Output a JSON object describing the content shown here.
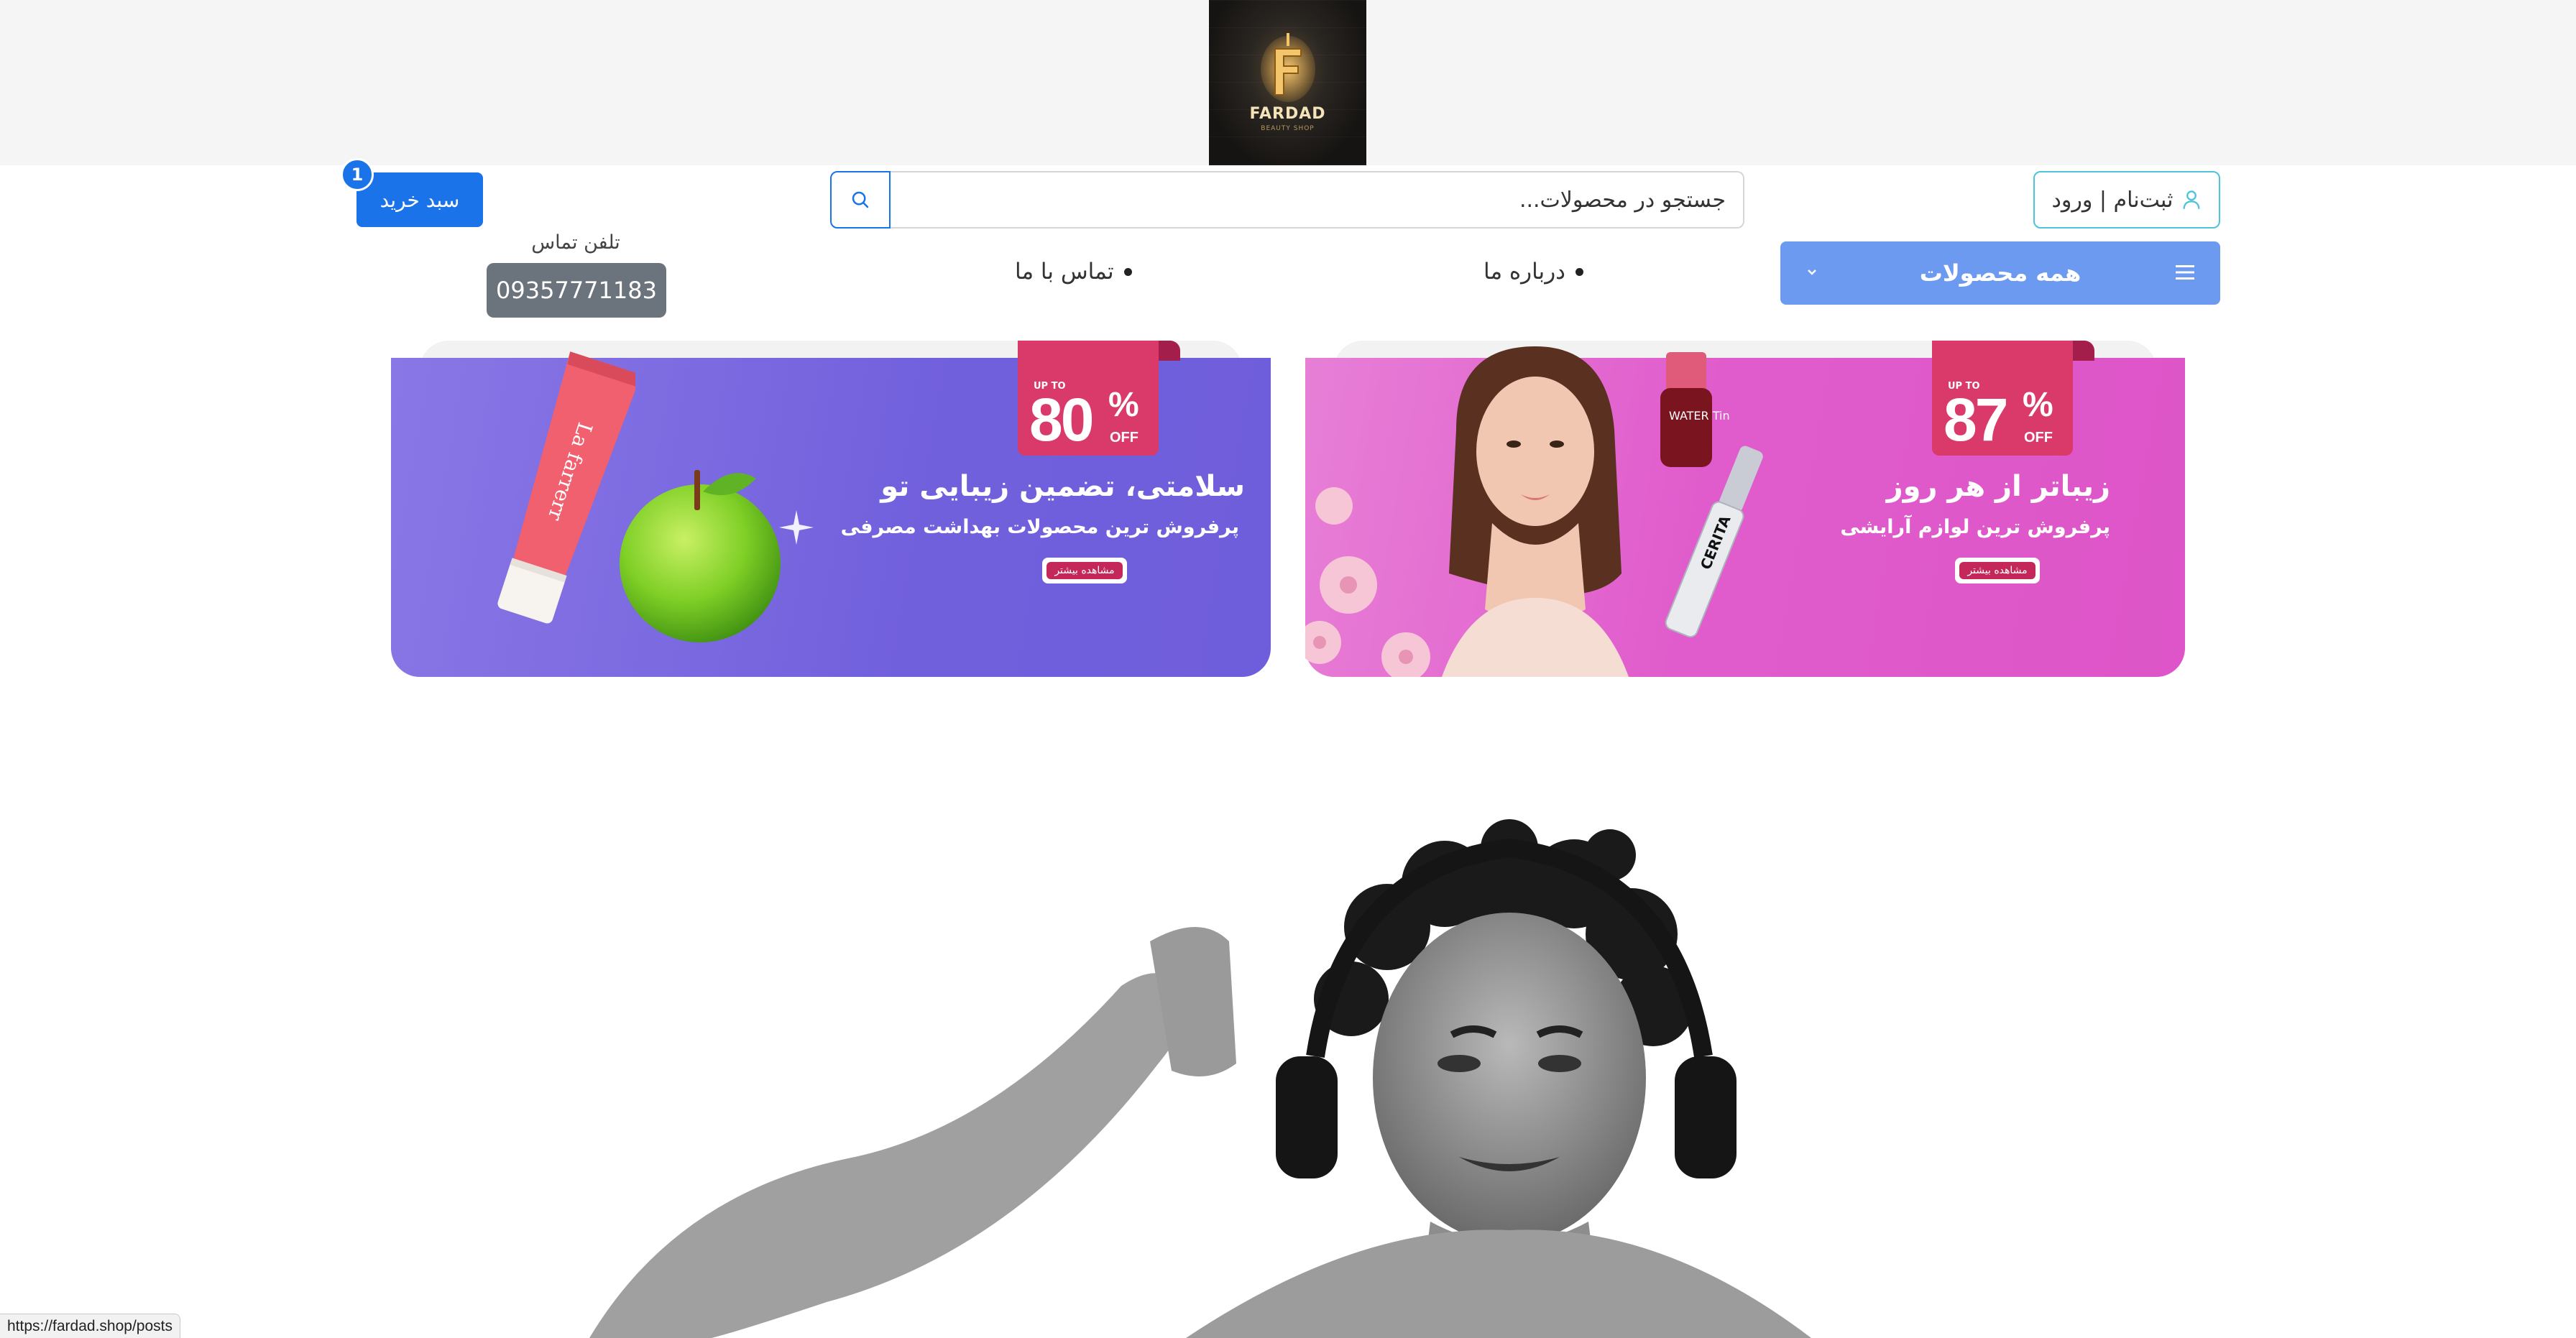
{
  "header": {
    "logo_text": "FARDAD",
    "logo_subtext": "BEAUTY SHOP",
    "cart_label": "سبد خرید",
    "cart_count": "1",
    "search_placeholder": "جستجو در محصولات...",
    "login_label": "ثبت‌نام | ورود"
  },
  "nav": {
    "all_products_label": "همه محصولات",
    "links": [
      {
        "label": "درباره ما"
      },
      {
        "label": "تماس با ما"
      }
    ],
    "phone_label": "تلفن تماس",
    "phone_number": "09357771183"
  },
  "banners": [
    {
      "discount_upto": "UP TO",
      "discount_value": "87",
      "discount_symbol": "%",
      "discount_off": "OFF",
      "title": "زیباتر از هر روز",
      "subtitle": "پرفروش ترین لوازم آرایشی",
      "button_label": "مشاهده بیشتر",
      "colors": {
        "bg": "#e05ccc",
        "tag": "#d93a6a"
      },
      "product_labels": [
        "WATER Tint",
        "CERITA"
      ]
    },
    {
      "discount_upto": "UP TO",
      "discount_value": "80",
      "discount_symbol": "%",
      "discount_off": "OFF",
      "title": "سلامتی، تضمین زیبایی تو",
      "subtitle": "پرفروش ترین محصولات بهداشت مصرفی",
      "button_label": "مشاهده بیشتر",
      "colors": {
        "bg": "#7465de",
        "tag": "#d93a6a"
      },
      "product_labels": [
        "La farrerr"
      ]
    }
  ],
  "status_bar": {
    "url": "https://fardad.shop/posts"
  },
  "colors": {
    "primary": "#1a73e8",
    "nav_blue": "#6b9af0",
    "login_border": "#4fc3d9",
    "phone_bg": "#6b737c"
  }
}
